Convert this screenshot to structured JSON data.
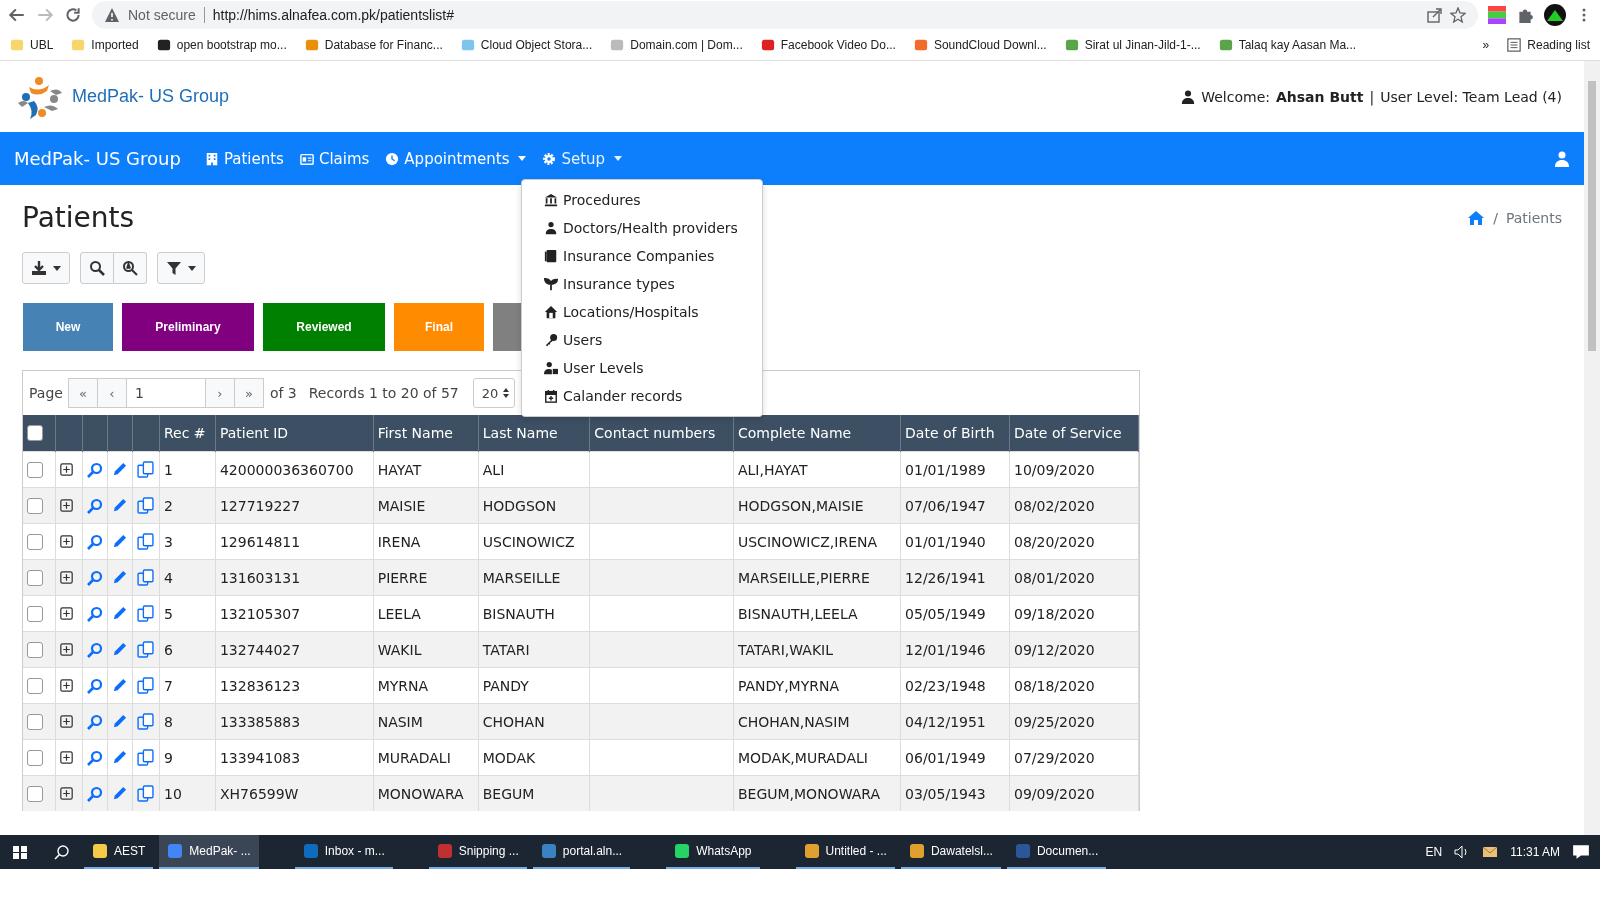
{
  "browser": {
    "security": "Not secure",
    "url": "http://hims.alnafea.com.pk/patientslist#",
    "bookmarks": [
      {
        "label": "UBL"
      },
      {
        "label": "Imported"
      },
      {
        "label": "open bootstrap mo..."
      },
      {
        "label": "Database for Financ..."
      },
      {
        "label": "Cloud Object Stora..."
      },
      {
        "label": "Domain.com | Dom..."
      },
      {
        "label": "Facebook Video Do..."
      },
      {
        "label": "SoundCloud Downl..."
      },
      {
        "label": "Sirat ul Jinan-Jild-1-..."
      },
      {
        "label": "Talaq kay Aasan Ma..."
      }
    ],
    "more": "»",
    "reading_list": "Reading list"
  },
  "header": {
    "brand": "MedPak- US Group",
    "welcome_label": "Welcome:",
    "user_name": "Ahsan Butt",
    "separator": "|",
    "user_level": "User Level: Team Lead (4)"
  },
  "navbar": {
    "brand": "MedPak- US Group",
    "items": [
      {
        "label": "Patients",
        "dropdown": false,
        "expanded": false
      },
      {
        "label": "Claims",
        "dropdown": false,
        "expanded": false
      },
      {
        "label": "Appointments",
        "dropdown": true,
        "expanded": false
      },
      {
        "label": "Setup",
        "dropdown": true,
        "expanded": true
      }
    ]
  },
  "setup_menu": [
    {
      "label": "Procedures"
    },
    {
      "label": "Doctors/Health providers"
    },
    {
      "label": "Insurance Companies"
    },
    {
      "label": "Insurance types"
    },
    {
      "label": "Locations/Hospitals"
    },
    {
      "label": "Users"
    },
    {
      "label": "User Levels"
    },
    {
      "label": "Calander records"
    }
  ],
  "page": {
    "title": "Patients",
    "breadcrumb_sep": "/",
    "breadcrumb": "Patients"
  },
  "status_buttons": [
    {
      "label": "New",
      "color": "#4682b4"
    },
    {
      "label": "Preliminary",
      "color": "#800080"
    },
    {
      "label": "Reviewed",
      "color": "#008000"
    },
    {
      "label": "Final",
      "color": "#ff8c00"
    },
    {
      "color": "#808080"
    }
  ],
  "pager": {
    "page_label": "Page",
    "first": "«",
    "prev": "‹",
    "page": "1",
    "next": "›",
    "last": "»",
    "of": "of 3",
    "records": "Records 1 to 20 of 57",
    "page_size": "20"
  },
  "table": {
    "select_all_checked": false,
    "columns": [
      "Rec #",
      "Patient ID",
      "First Name",
      "Last Name",
      "Contact numbers",
      "Complete Name",
      "Date of Birth",
      "Date of Service"
    ],
    "rows": [
      {
        "checked": false,
        "cells": [
          "1",
          "420000036360700",
          "HAYAT",
          "ALI",
          "",
          "ALI,HAYAT",
          "01/01/1989",
          "10/09/2020"
        ]
      },
      {
        "checked": false,
        "cells": [
          "2",
          "127719227",
          "MAISIE",
          "HODGSON",
          "",
          "HODGSON,MAISIE",
          "07/06/1947",
          "08/02/2020"
        ]
      },
      {
        "checked": false,
        "cells": [
          "3",
          "129614811",
          "IRENA",
          "USCINOWICZ",
          "",
          "USCINOWICZ,IRENA",
          "01/01/1940",
          "08/20/2020"
        ]
      },
      {
        "checked": false,
        "cells": [
          "4",
          "131603131",
          "PIERRE",
          "MARSEILLE",
          "",
          "MARSEILLE,PIERRE",
          "12/26/1941",
          "08/01/2020"
        ]
      },
      {
        "checked": false,
        "cells": [
          "5",
          "132105307",
          "LEELA",
          "BISNAUTH",
          "",
          "BISNAUTH,LEELA",
          "05/05/1949",
          "09/18/2020"
        ]
      },
      {
        "checked": false,
        "cells": [
          "6",
          "132744027",
          "WAKIL",
          "TATARI",
          "",
          "TATARI,WAKIL",
          "12/01/1946",
          "09/12/2020"
        ]
      },
      {
        "checked": false,
        "cells": [
          "7",
          "132836123",
          "MYRNA",
          "PANDY",
          "",
          "PANDY,MYRNA",
          "02/23/1948",
          "08/18/2020"
        ]
      },
      {
        "checked": false,
        "cells": [
          "8",
          "133385883",
          "NASIM",
          "CHOHAN",
          "",
          "CHOHAN,NASIM",
          "04/12/1951",
          "09/25/2020"
        ]
      },
      {
        "checked": false,
        "cells": [
          "9",
          "133941083",
          "MURADALI",
          "MODAK",
          "",
          "MODAK,MURADALI",
          "06/01/1949",
          "07/29/2020"
        ]
      },
      {
        "checked": false,
        "cells": [
          "10",
          "XH76599W",
          "MONOWARA",
          "BEGUM",
          "",
          "BEGUM,MONOWARA",
          "03/05/1943",
          "09/09/2020"
        ]
      }
    ]
  },
  "taskbar": {
    "items": [
      {
        "label": "AEST",
        "selected": false
      },
      {
        "label": "MedPak- ...",
        "selected": true
      },
      {
        "label": "Inbox - m...",
        "selected": false
      },
      {
        "label": "Snipping ...",
        "selected": false
      },
      {
        "label": "portal.aln...",
        "selected": false
      },
      {
        "label": "WhatsApp",
        "selected": false
      },
      {
        "label": "Untitled - ...",
        "selected": false
      },
      {
        "label": "Dawatelsl...",
        "selected": false
      },
      {
        "label": "Documen...",
        "selected": false
      }
    ],
    "language": "EN",
    "time": "11:31 AM"
  }
}
